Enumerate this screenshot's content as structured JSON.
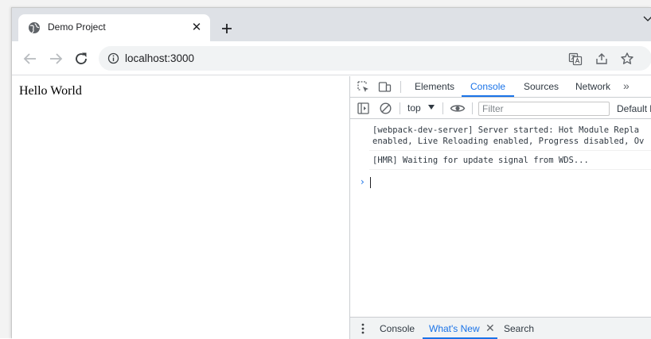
{
  "browser": {
    "tab": {
      "title": "Demo Project",
      "favicon": "globe-icon",
      "close_glyph": "✕"
    },
    "new_tab_icon": "plus-icon",
    "toolbar": {
      "url": "localhost:3000",
      "icons": [
        "back-icon",
        "forward-icon",
        "reload-icon",
        "info-icon",
        "translate-icon",
        "share-icon",
        "bookmark-star-icon"
      ]
    }
  },
  "page": {
    "text": "Hello World"
  },
  "devtools": {
    "tabs": [
      "Elements",
      "Console",
      "Sources",
      "Network"
    ],
    "active_tab": "Console",
    "more_tabs": "»",
    "context": "top",
    "filter_placeholder": "Filter",
    "levels_label": "Default l",
    "messages": [
      "[webpack-dev-server] Server started: Hot Module Repla\nenabled, Live Reloading enabled, Progress disabled, Ov",
      "[HMR] Waiting for update signal from WDS..."
    ],
    "prompt": "›",
    "drawer": {
      "tabs": [
        "Console",
        "What's New",
        "Search"
      ],
      "active_tab": "What's New",
      "close_glyph": "✕"
    },
    "colors": {
      "accent": "#1a73e8",
      "tabstrip": "#dee1e6",
      "omnibox": "#f1f3f4"
    }
  }
}
